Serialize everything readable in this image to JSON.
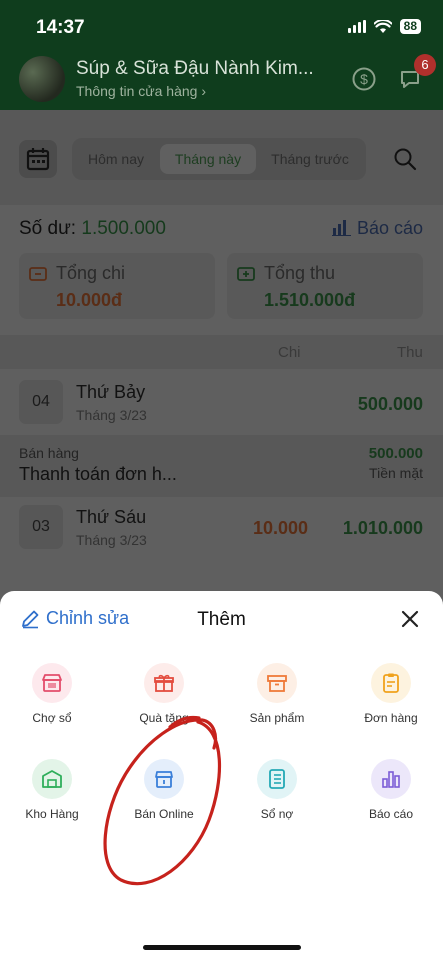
{
  "status_bar": {
    "time": "14:37",
    "battery": "88"
  },
  "header": {
    "store_name": "Súp & Sữa Đậu Nành Kim...",
    "store_subtitle": "Thông tin cửa hàng ›",
    "notification_count": "6"
  },
  "filter_tabs": [
    {
      "label": "Hôm nay"
    },
    {
      "label": "Tháng này"
    },
    {
      "label": "Tháng trước"
    }
  ],
  "summary": {
    "balance_label": "Số dư:",
    "balance_value": "1.500.000",
    "report_label": "Báo cáo",
    "expense_label": "Tổng chi",
    "expense_value": "10.000đ",
    "income_label": "Tổng thu",
    "income_value": "1.510.000đ"
  },
  "columns": {
    "expense": "Chi",
    "income": "Thu"
  },
  "days": [
    {
      "day": "04",
      "name": "Thứ Bảy",
      "month": "Tháng 3/23",
      "expense": "",
      "income": "500.000"
    },
    {
      "day": "03",
      "name": "Thứ Sáu",
      "month": "Tháng 3/23",
      "expense": "10.000",
      "income": "1.010.000"
    }
  ],
  "transaction": {
    "category": "Bán hàng",
    "description": "Thanh toán đơn h...",
    "amount": "500.000",
    "method": "Tiền mặt"
  },
  "sheet": {
    "edit_label": "Chỉnh sửa",
    "title": "Thêm",
    "actions": [
      {
        "label": "Chợ sổ",
        "icon": "store-icon",
        "color": "#e34d6b"
      },
      {
        "label": "Quà tặng",
        "icon": "gift-icon",
        "color": "#e34d3f"
      },
      {
        "label": "Sản phẩm",
        "icon": "box-icon",
        "color": "#ef7a3a"
      },
      {
        "label": "Đơn hàng",
        "icon": "clipboard-icon",
        "color": "#f0a21c"
      },
      {
        "label": "Kho Hàng",
        "icon": "warehouse-icon",
        "color": "#2fae5b"
      },
      {
        "label": "Bán Online",
        "icon": "online-shop-icon",
        "color": "#3a7fd9"
      },
      {
        "label": "Sổ nợ",
        "icon": "notebook-icon",
        "color": "#24a9b5"
      },
      {
        "label": "Báo cáo",
        "icon": "bar-chart-icon",
        "color": "#7c5cd6"
      }
    ]
  },
  "colors": {
    "header_green": "#0f3d1d",
    "accent_blue": "#2f6fcb",
    "annotation_red": "#c6221c"
  }
}
